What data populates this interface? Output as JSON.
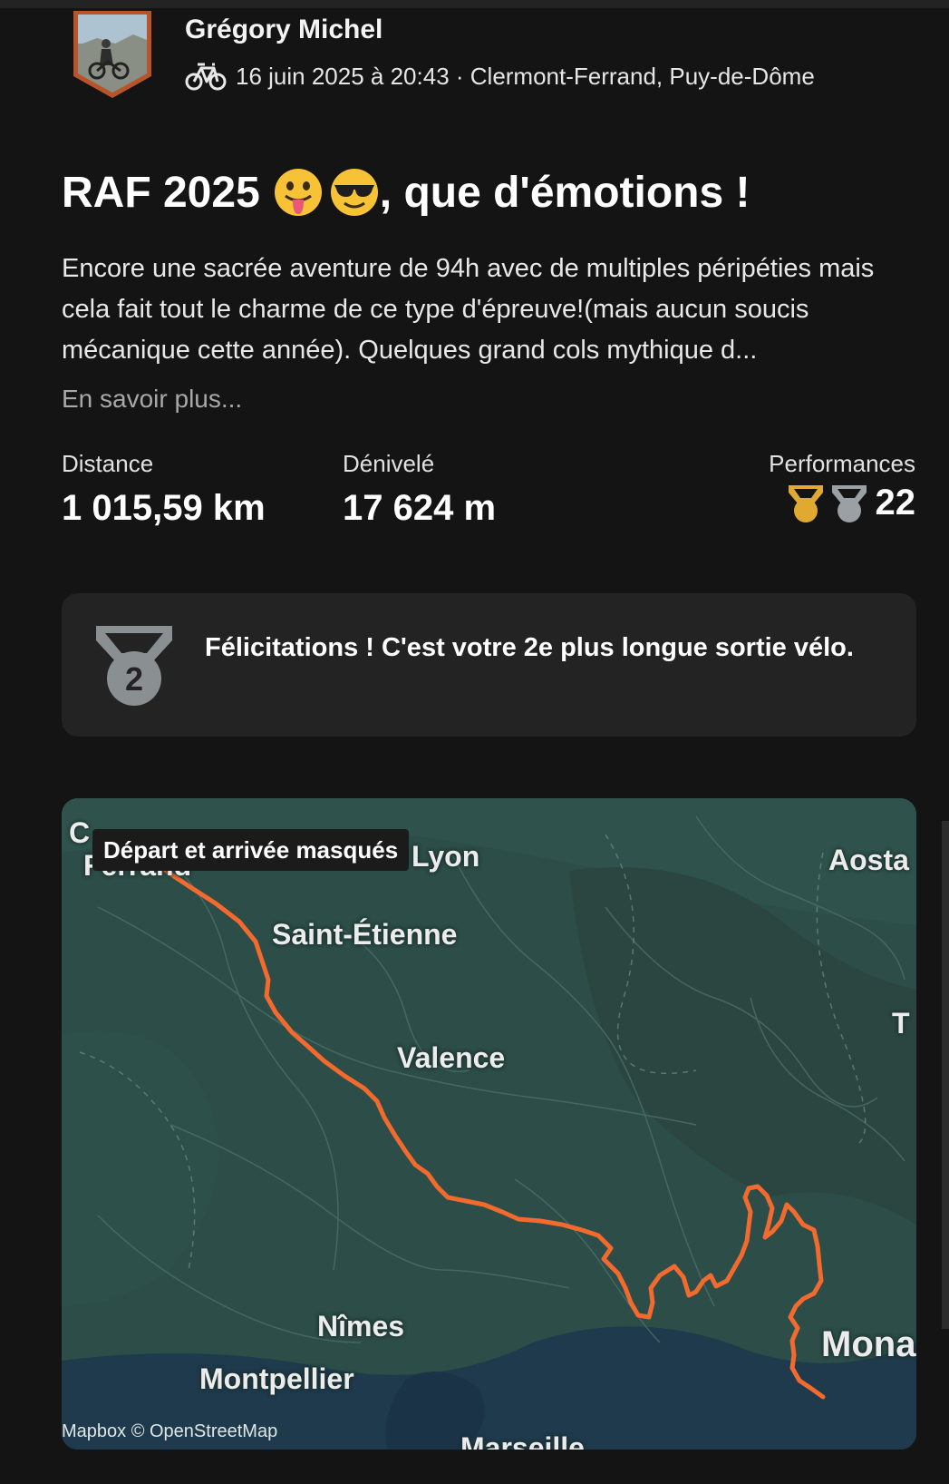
{
  "athlete": {
    "name": "Grégory Michel",
    "activity_icon": "bicycle-icon",
    "datetime": "16 juin 2025 à 20:43",
    "separator": " · ",
    "location": "Clermont-Ferrand, Puy-de-Dôme"
  },
  "activity": {
    "title_text": "RAF 2025",
    "title_emojis": [
      "tongue-out-emoji",
      "sunglasses-emoji"
    ],
    "title_suffix": ", que d'émotions !",
    "description": "Encore une sacrée aventure de 94h avec de multiples péripéties mais cela fait tout le charme de ce type d'épreuve!(mais aucun soucis mécanique cette année). Quelques grand cols mythique d...",
    "read_more": "En savoir plus..."
  },
  "stats": {
    "distance_label": "Distance",
    "distance_value": "1 015,59 km",
    "elevation_label": "Dénivelé",
    "elevation_value": "17 624 m",
    "performances_label": "Performances",
    "performances_count": "22",
    "performance_icons": [
      "gold-medal-icon",
      "silver-medal-icon"
    ]
  },
  "achievement": {
    "icon": "second-place-medal-icon",
    "medal_number": "2",
    "text": "Félicitations ! C'est votre 2e plus longue sortie vélo."
  },
  "map": {
    "masked_label": "Départ et arrivée masqués",
    "attribution": "Mapbox © OpenStreetMap",
    "route_color": "#f26a2e",
    "labels": {
      "clermont_top": "C",
      "clermont_bottom": "Ferrand",
      "lyon": "Lyon",
      "aosta": "Aosta",
      "saint_etienne": "Saint-Étienne",
      "valence": "Valence",
      "turin": "T",
      "nimes": "Nîmes",
      "montpellier": "Montpellier",
      "monaco": "Mona",
      "marseille": "Marseille"
    }
  },
  "colors": {
    "background": "#141414",
    "card": "#232323",
    "text_primary": "#ffffff",
    "text_secondary": "#a8a8a8",
    "gold": "#e2a930",
    "silver": "#9aa0a4"
  }
}
